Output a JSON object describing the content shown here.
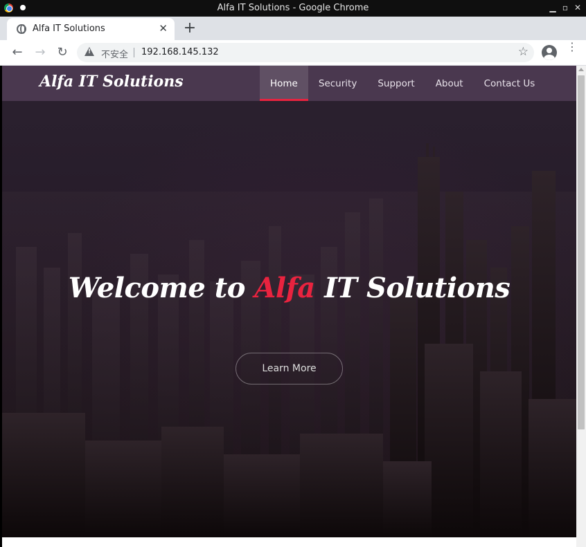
{
  "window": {
    "title": "Alfa IT Solutions - Google Chrome"
  },
  "tab": {
    "title": "Alfa IT Solutions",
    "close": "✕",
    "new_tab": "+"
  },
  "toolbar": {
    "back": "←",
    "forward": "→",
    "reload": "↻",
    "security_label": "不安全",
    "url": "192.168.145.132",
    "bookmark": "☆",
    "menu": "⋮"
  },
  "site": {
    "brand": "Alfa IT Solutions",
    "nav": [
      {
        "label": "Home",
        "active": true
      },
      {
        "label": "Security",
        "active": false
      },
      {
        "label": "Support",
        "active": false
      },
      {
        "label": "About",
        "active": false
      },
      {
        "label": "Contact Us",
        "active": false
      }
    ],
    "hero": {
      "headline_pre": "Welcome to ",
      "headline_accent": "Alfa",
      "headline_post": " IT Solutions",
      "cta": "Learn More"
    }
  },
  "colors": {
    "accent": "#e9233f",
    "navbar": "#503c55",
    "hero_dark": "#261a28"
  }
}
